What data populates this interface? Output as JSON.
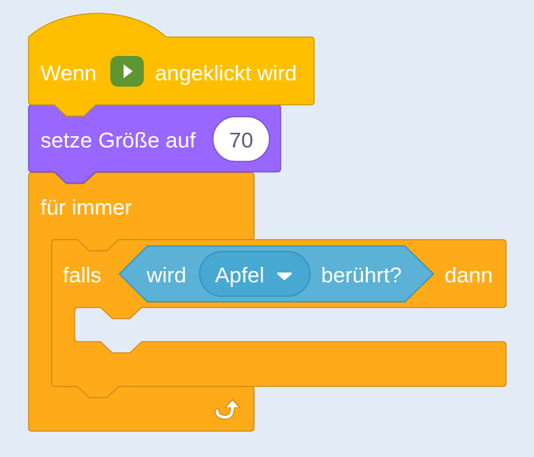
{
  "script": {
    "hat_block": {
      "label_before": "Wenn",
      "flag_icon": "green-flag-icon",
      "label_after": "angeklickt wird"
    },
    "size_block": {
      "label": "setze Größe auf",
      "value": "70"
    },
    "forever_block": {
      "label": "für immer",
      "loop_icon": "loop-arrow-icon"
    },
    "if_block": {
      "label_if": "falls",
      "label_then": "dann"
    },
    "touching_block": {
      "label_before": "wird",
      "target": "Apfel",
      "dropdown_icon": "dropdown-arrow-icon",
      "label_after": "berührt?"
    }
  },
  "colors": {
    "events": "#ffbf00",
    "events_border": "#cc9900",
    "looks": "#9966ff",
    "looks_border": "#774dcb",
    "control": "#ffab19",
    "control_border": "#cf8b17",
    "sensing": "#5cb1d6",
    "sensing_border": "#2e8eb8",
    "flag_bg": "#5f9634"
  }
}
